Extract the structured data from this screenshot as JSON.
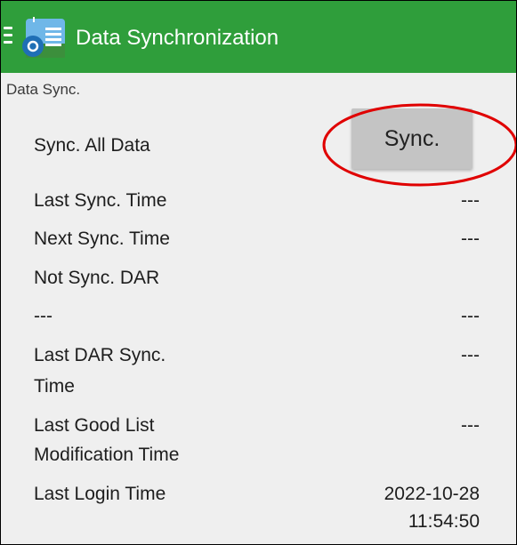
{
  "app": {
    "title": "Data Synchronization"
  },
  "section": {
    "label": "Data Sync."
  },
  "sync_all": {
    "label": "Sync. All Data",
    "button_label": "Sync."
  },
  "rows": [
    {
      "label": "Last Sync. Time",
      "value": "---"
    },
    {
      "label": "Next Sync. Time",
      "value": "---"
    },
    {
      "label": "Not Sync. DAR",
      "value": ""
    },
    {
      "label": "---",
      "value": "---"
    },
    {
      "label_lines": [
        "Last DAR Sync.",
        "Time"
      ],
      "value": "---"
    },
    {
      "label_lines": [
        "Last Good List",
        "Modification Time"
      ],
      "value": "---"
    },
    {
      "label": "Last Login Time",
      "value_lines": [
        "2022-10-28",
        "11:54:50"
      ]
    }
  ],
  "colors": {
    "appbar": "#2f9e3b",
    "annotation": "#e00000",
    "button": "#c4c4c4"
  }
}
